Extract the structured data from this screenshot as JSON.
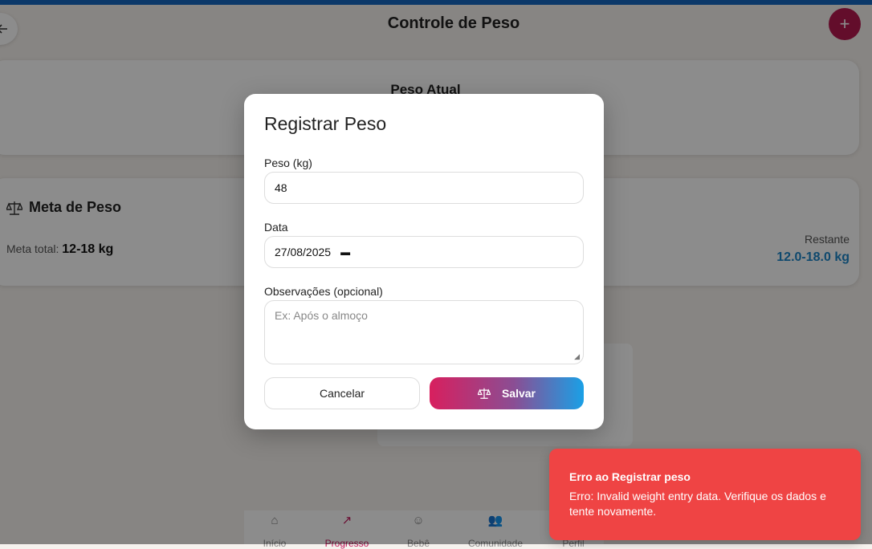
{
  "header": {
    "title": "Controle de Peso",
    "back_icon": "arrow-left-icon",
    "add_label": "+"
  },
  "current_weight": {
    "title": "Peso Atual"
  },
  "goal": {
    "title": "Meta de Peso",
    "total_label": "Meta total:",
    "total_value": "12-18 kg",
    "remaining_label": "Restante",
    "remaining_value": "12.0-18.0 kg",
    "value_color": "#1d86c8"
  },
  "bottom_nav": [
    {
      "label": "Início",
      "icon": "home-icon"
    },
    {
      "label": "Progresso",
      "icon": "trending-up-icon",
      "active": true
    },
    {
      "label": "Bebê",
      "icon": "baby-icon"
    },
    {
      "label": "Comunidade",
      "icon": "users-icon"
    },
    {
      "label": "Perfil",
      "icon": "user-icon"
    }
  ],
  "modal": {
    "title": "Registrar Peso",
    "weight_label": "Peso (kg)",
    "weight_value": "48",
    "date_label": "Data",
    "date_value": "27/08/2025",
    "notes_label": "Observações (opcional)",
    "notes_placeholder": "Ex: Após o almoço",
    "cancel_label": "Cancelar",
    "save_label": "Salvar"
  },
  "toast": {
    "title": "Erro ao Registrar peso",
    "message": "Erro: Invalid weight entry data. Verifique os dados e tente novamente.",
    "color": "#ef4444"
  },
  "colors": {
    "accent": "#1566c0",
    "brand": "#b5194f"
  }
}
